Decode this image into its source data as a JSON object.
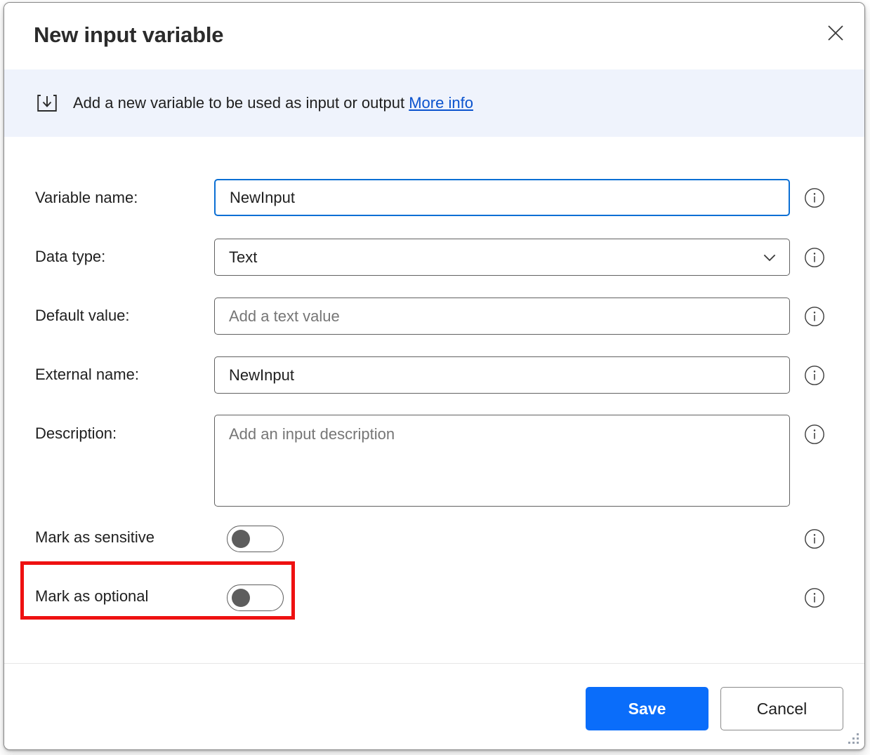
{
  "window": {
    "title": "New input variable",
    "close_icon": "close-icon",
    "resize_grip": "resize-grip"
  },
  "banner": {
    "icon": "import-input-icon",
    "text": "Add a new variable to be used as input or output",
    "link_label": "More info",
    "background_color": "#eff3fc",
    "link_color": "#0b53ce"
  },
  "form": {
    "fields": [
      {
        "label": "Variable name:",
        "type": "text",
        "value": "NewInput",
        "placeholder": "",
        "focused": true,
        "info_icon": "info-icon"
      },
      {
        "label": "Data type:",
        "type": "select",
        "value": "Text",
        "placeholder": "",
        "focused": false,
        "info_icon": "info-icon",
        "chevron_icon": "chevron-down-icon"
      },
      {
        "label": "Default value:",
        "type": "text",
        "value": "",
        "placeholder": "Add a text value",
        "focused": false,
        "info_icon": "info-icon"
      },
      {
        "label": "External name:",
        "type": "text",
        "value": "NewInput",
        "placeholder": "",
        "focused": false,
        "info_icon": "info-icon"
      },
      {
        "label": "Description:",
        "type": "textarea",
        "value": "",
        "placeholder": "Add an input description",
        "focused": false,
        "info_icon": "info-icon"
      }
    ],
    "toggles": [
      {
        "label": "Mark as sensitive",
        "state": "off",
        "info_icon": "info-icon",
        "highlighted": false
      },
      {
        "label": "Mark as optional",
        "state": "off",
        "info_icon": "info-icon",
        "highlighted": true
      }
    ]
  },
  "highlight": {
    "color": "#ee1111",
    "target": "Mark as optional"
  },
  "footer": {
    "save_label": "Save",
    "cancel_label": "Cancel",
    "primary_color": "#0a6dfa"
  }
}
